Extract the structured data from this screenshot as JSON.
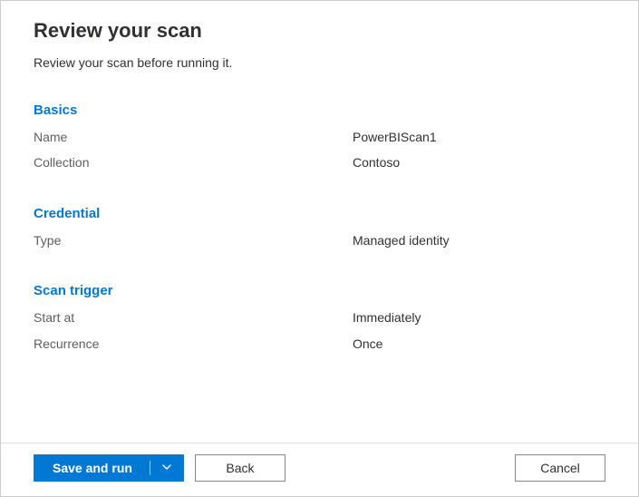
{
  "header": {
    "title": "Review your scan",
    "subtitle": "Review your scan before running it."
  },
  "sections": {
    "basics": {
      "heading": "Basics",
      "name_label": "Name",
      "name_value": "PowerBIScan1",
      "collection_label": "Collection",
      "collection_value": "Contoso"
    },
    "credential": {
      "heading": "Credential",
      "type_label": "Type",
      "type_value": "Managed identity"
    },
    "trigger": {
      "heading": "Scan trigger",
      "start_label": "Start at",
      "start_value": "Immediately",
      "recurrence_label": "Recurrence",
      "recurrence_value": "Once"
    }
  },
  "footer": {
    "primary_label": "Save and run",
    "back_label": "Back",
    "cancel_label": "Cancel"
  }
}
